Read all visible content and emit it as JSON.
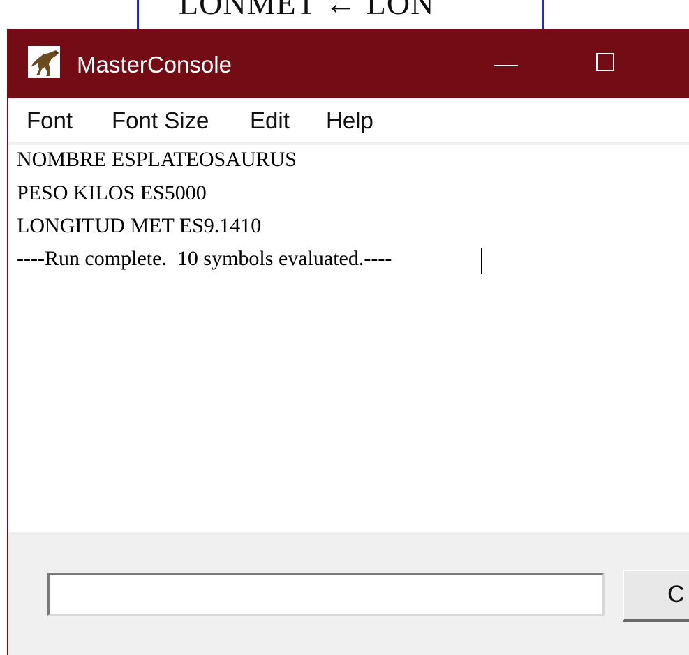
{
  "background": {
    "diagram_text": "LONMET ← LON"
  },
  "window": {
    "title": "MasterConsole",
    "icon": "dinosaur-app-icon",
    "controls": {
      "minimize": "minimize-icon",
      "maximize": "maximize-icon"
    },
    "colors": {
      "titlebar": "#740c15",
      "title_text": "#ffffff"
    }
  },
  "menu": {
    "font": "Font",
    "font_size": "Font Size",
    "edit": "Edit",
    "help": "Help"
  },
  "console": {
    "lines": [
      "NOMBRE ESPLATEOSAURUS",
      "PESO KILOS ES5000",
      "LONGITUD MET ES9.1410",
      "----Run complete.  10 symbols evaluated.----"
    ]
  },
  "command": {
    "input_value": "",
    "button_label": "C"
  }
}
